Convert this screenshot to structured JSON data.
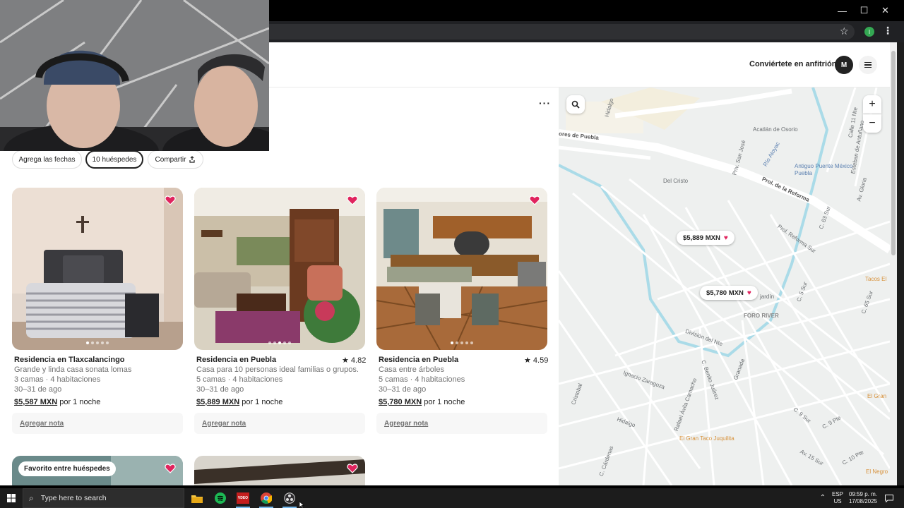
{
  "browser": {
    "window_controls": {
      "minimize": "—",
      "maximize": "☐",
      "close": "✕"
    },
    "profile_initial": "I"
  },
  "header": {
    "host_link": "Conviértete en anfitrión",
    "avatar_initial": "M"
  },
  "more_options": "···",
  "filters": {
    "dates": "Agrega las fechas",
    "guests": "10 huéspedes",
    "share": "Compartir"
  },
  "listings": [
    {
      "title": "Residencia en Tlaxcalancingo",
      "rating": "",
      "description": "Grande y linda casa sonata lomas",
      "beds": "3 camas · 4 habitaciones",
      "dates": "30–31 de ago",
      "price": "$5,587 MXN",
      "price_suffix": "por 1 noche",
      "note": "Agregar nota"
    },
    {
      "title": "Residencia en Puebla",
      "rating": "★ 4.82",
      "description": "Casa para 10 personas ideal familias o grupos.",
      "beds": "5 camas · 4 habitaciones",
      "dates": "30–31 de ago",
      "price": "$5,889 MXN",
      "price_suffix": "por 1 noche",
      "note": "Agregar nota"
    },
    {
      "title": "Residencia en Puebla",
      "rating": "★ 4.59",
      "description": "Casa entre árboles",
      "beds": "5 camas · 4 habitaciones",
      "dates": "30–31 de ago",
      "price": "$5,780 MXN",
      "price_suffix": "por 1 noche",
      "note": "Agregar nota"
    }
  ],
  "guest_favorite_badge": "Favorito entre huéspedes",
  "map": {
    "zoom_in": "+",
    "zoom_out": "−",
    "pins": [
      {
        "label": "$5,889 MXN"
      },
      {
        "label": "$5,780 MXN"
      }
    ],
    "labels": {
      "hidalgo_top": "Hidalgo",
      "puebla_road": "ores de Puebla",
      "acatlan": "Acatlán de Osorio",
      "antiguo_puente": "Antiguo Puente México-Puebla",
      "reforma": "Prol. de la Reforma",
      "reforma_sur": "Prol. Reforma Sur",
      "rio_atoyac": "Río Atoyac",
      "del_cristo": "Del Cristo",
      "jardin": "jardín",
      "foro_river": "FORO RIVER",
      "division": "División del Nte",
      "ignacio": "Ignacio Zaragoza",
      "benito": "C. Benito Juárez",
      "rafael": "Rafael Ávila Camacho",
      "granada": "Granada",
      "hidalgo_bottom": "Hidalgo",
      "gran_taco": "El Gran Taco Juquilita",
      "tacos": "Tacos El",
      "el_gran": "El Gran",
      "el_negro": "El Negro",
      "cristobal": "Cristobal",
      "cardenas": "C. Cárdenas",
      "c5sur": "C. 5 Sur",
      "c9sur": "C. 9 Sur",
      "c63sur": "C. 63 Sur",
      "c65sur": "C. 65 Sur",
      "calle11": "Calle 11 Nte",
      "av_gloria": "Av. Gloria",
      "esteban": "Esteban de Antuñano",
      "pino_suarez": "Priv. San José",
      "av15sur": "Av. 15 Sur",
      "c10pte": "C. 10 Pte",
      "c9pte": "C. 9 Pte"
    }
  },
  "taskbar": {
    "search_placeholder": "Type here to search",
    "lang_top": "ESP",
    "lang_bottom": "US",
    "time": "09:59 p. m.",
    "date": "17/08/2025",
    "vdeo_label": "VDEO"
  },
  "colors": {
    "brand": "#e0245e",
    "map_water": "#aadbe8",
    "map_block": "#f5f2e8"
  }
}
